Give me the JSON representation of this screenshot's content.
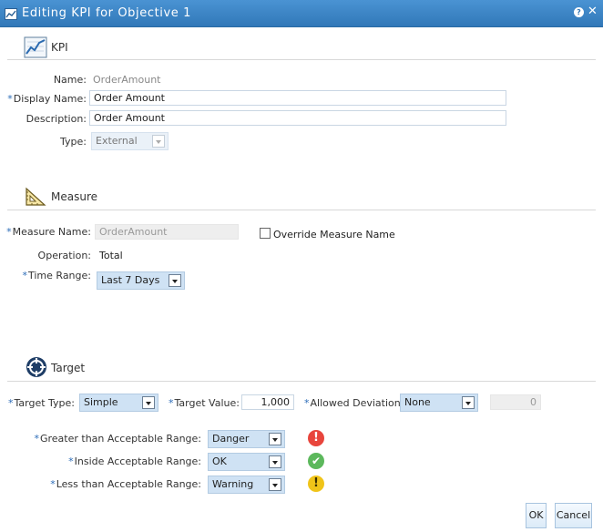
{
  "window": {
    "title": "Editing KPI for Objective 1",
    "help_icon": "help-icon",
    "close_icon": "close-icon"
  },
  "kpi_section": {
    "heading": "KPI",
    "icon": "kpi-chart-icon",
    "name_label": "Name:",
    "name_value": "OrderAmount",
    "display_name_label": "Display Name:",
    "display_name_value": "Order Amount",
    "description_label": "Description:",
    "description_value": "Order Amount",
    "type_label": "Type:",
    "type_value": "External"
  },
  "measure_section": {
    "heading": "Measure",
    "icon": "measure-ruler-icon",
    "measure_name_label": "Measure Name:",
    "measure_name_value": "OrderAmount",
    "override_label": "Override Measure Name",
    "override_checked": false,
    "operation_label": "Operation:",
    "operation_value": "Total",
    "time_range_label": "Time Range:",
    "time_range_value": "Last 7 Days"
  },
  "target_section": {
    "heading": "Target",
    "icon": "target-crosshair-icon",
    "target_type_label": "Target Type:",
    "target_type_value": "Simple",
    "target_value_label": "Target Value:",
    "target_value": "1,000",
    "allowed_deviation_label": "Allowed Deviation:",
    "allowed_deviation_value": "None",
    "deviation_amount": "0",
    "ranges": [
      {
        "label": "Greater than Acceptable Range:",
        "value": "Danger",
        "status_icon": "danger-icon",
        "color": "#e8453c",
        "glyph": "!"
      },
      {
        "label": "Inside Acceptable Range:",
        "value": "OK",
        "status_icon": "ok-check-icon",
        "color": "#5cb85c",
        "glyph": "✔"
      },
      {
        "label": "Less than Acceptable Range:",
        "value": "Warning",
        "status_icon": "warning-icon",
        "color": "#f0c419",
        "glyph": "!"
      }
    ]
  },
  "footer": {
    "ok_label": "OK",
    "cancel_label": "Cancel"
  },
  "colors": {
    "titlebar": "#3a84c6",
    "required_marker": "#2b6cb8",
    "select_bg": "#cfe2f4"
  }
}
